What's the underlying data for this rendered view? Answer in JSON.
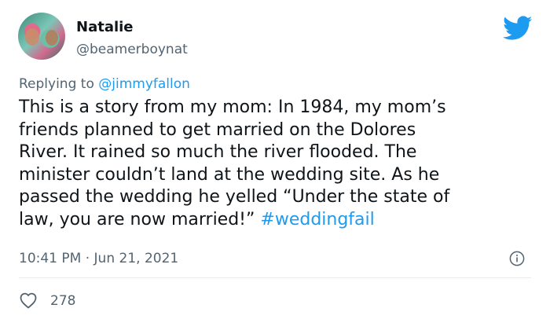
{
  "user": {
    "name": "Natalie",
    "handle": "@beamerboynat"
  },
  "reply": {
    "prefix": "Replying to ",
    "mention": "@jimmyfallon"
  },
  "tweet": {
    "lines": [
      "This is a story from my mom: In 1984, my mom’s",
      "friends planned to get married on the Dolores",
      "River. It rained so much the river flooded. The",
      "minister couldn’t land at the wedding site. As he",
      "passed the wedding he yelled “Under the state of"
    ],
    "last_line": "law, you are now married!” ",
    "hashtag": "#weddingfail"
  },
  "meta": {
    "time": "10:41 PM",
    "separator": " · ",
    "date": "Jun 21, 2021"
  },
  "actions": {
    "like_count": "278"
  },
  "colors": {
    "accent": "#1d9bf0",
    "muted": "#536471",
    "text": "#0f1419"
  },
  "icons": [
    "twitter-bird-icon",
    "info-icon",
    "heart-icon"
  ]
}
